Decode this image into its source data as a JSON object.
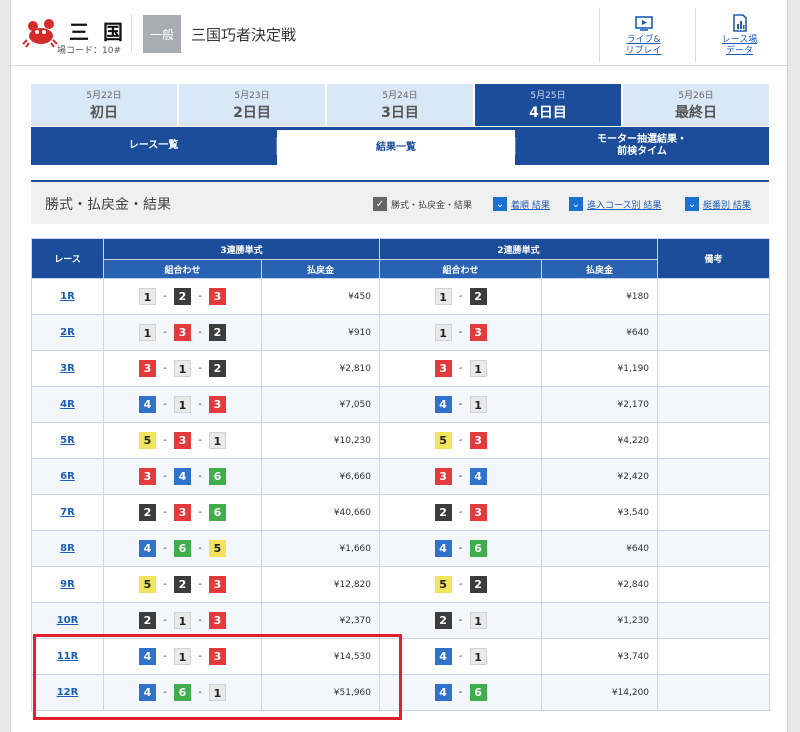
{
  "header": {
    "venue": "三国",
    "venue_code": "場コード：10#",
    "grade": "一般",
    "race_name": "三国巧者決定戦",
    "live_replay": "ライブ&\nリプレイ",
    "venue_data": "レース場\nデータ",
    "icons": [
      "crab-logo-icon",
      "tv-play-icon",
      "bar-chart-icon"
    ]
  },
  "days": [
    {
      "date": "5月22日",
      "label": "初日",
      "active": false
    },
    {
      "date": "5月23日",
      "label": "2日目",
      "active": false
    },
    {
      "date": "5月24日",
      "label": "3日目",
      "active": false
    },
    {
      "date": "5月25日",
      "label": "4日目",
      "active": true
    },
    {
      "date": "5月26日",
      "label": "最終日",
      "active": false
    }
  ],
  "subtabs": {
    "race_list": "レース一覧",
    "results": "結果一覧",
    "motor": "モーター抽選結果・\n前検タイム"
  },
  "section": {
    "title": "勝式・払戻金・結果",
    "filters": [
      {
        "label": "勝式・払戻金・結果",
        "style": "gray"
      },
      {
        "label": "着順 結果",
        "style": "blue"
      },
      {
        "label": "進入コース別 結果",
        "style": "blue"
      },
      {
        "label": "艇番別 結果",
        "style": "blue"
      }
    ]
  },
  "table": {
    "col_race": "レース",
    "col_trifecta": "3連勝単式",
    "col_exacta": "2連勝単式",
    "col_note": "備考",
    "col_combo": "組合わせ",
    "col_payout": "払戻金",
    "rows": [
      {
        "race": "1R",
        "tri": [
          1,
          2,
          3
        ],
        "tri_pay": "¥450",
        "ex": [
          1,
          2
        ],
        "ex_pay": "¥180"
      },
      {
        "race": "2R",
        "tri": [
          1,
          3,
          2
        ],
        "tri_pay": "¥910",
        "ex": [
          1,
          3
        ],
        "ex_pay": "¥640"
      },
      {
        "race": "3R",
        "tri": [
          3,
          1,
          2
        ],
        "tri_pay": "¥2,810",
        "ex": [
          3,
          1
        ],
        "ex_pay": "¥1,190"
      },
      {
        "race": "4R",
        "tri": [
          4,
          1,
          3
        ],
        "tri_pay": "¥7,050",
        "ex": [
          4,
          1
        ],
        "ex_pay": "¥2,170"
      },
      {
        "race": "5R",
        "tri": [
          5,
          3,
          1
        ],
        "tri_pay": "¥10,230",
        "ex": [
          5,
          3
        ],
        "ex_pay": "¥4,220"
      },
      {
        "race": "6R",
        "tri": [
          3,
          4,
          6
        ],
        "tri_pay": "¥6,660",
        "ex": [
          3,
          4
        ],
        "ex_pay": "¥2,420"
      },
      {
        "race": "7R",
        "tri": [
          2,
          3,
          6
        ],
        "tri_pay": "¥40,660",
        "ex": [
          2,
          3
        ],
        "ex_pay": "¥3,540"
      },
      {
        "race": "8R",
        "tri": [
          4,
          6,
          5
        ],
        "tri_pay": "¥1,660",
        "ex": [
          4,
          6
        ],
        "ex_pay": "¥640"
      },
      {
        "race": "9R",
        "tri": [
          5,
          2,
          3
        ],
        "tri_pay": "¥12,820",
        "ex": [
          5,
          2
        ],
        "ex_pay": "¥2,840"
      },
      {
        "race": "10R",
        "tri": [
          2,
          1,
          3
        ],
        "tri_pay": "¥2,370",
        "ex": [
          2,
          1
        ],
        "ex_pay": "¥1,230"
      },
      {
        "race": "11R",
        "tri": [
          4,
          1,
          3
        ],
        "tri_pay": "¥14,530",
        "ex": [
          4,
          1
        ],
        "ex_pay": "¥3,740"
      },
      {
        "race": "12R",
        "tri": [
          4,
          6,
          1
        ],
        "tri_pay": "¥51,960",
        "ex": [
          4,
          6
        ],
        "ex_pay": "¥14,200"
      }
    ]
  },
  "colors": {
    "primary": "#1b4d9b",
    "link": "#1e5db5",
    "highlight": "#e0202a",
    "boat_1": "#e9e9e9",
    "boat_2": "#3c3c3c",
    "boat_3": "#e33b3b",
    "boat_4": "#2f72cc",
    "boat_5": "#f1e45c",
    "boat_6": "#3fae4b"
  }
}
